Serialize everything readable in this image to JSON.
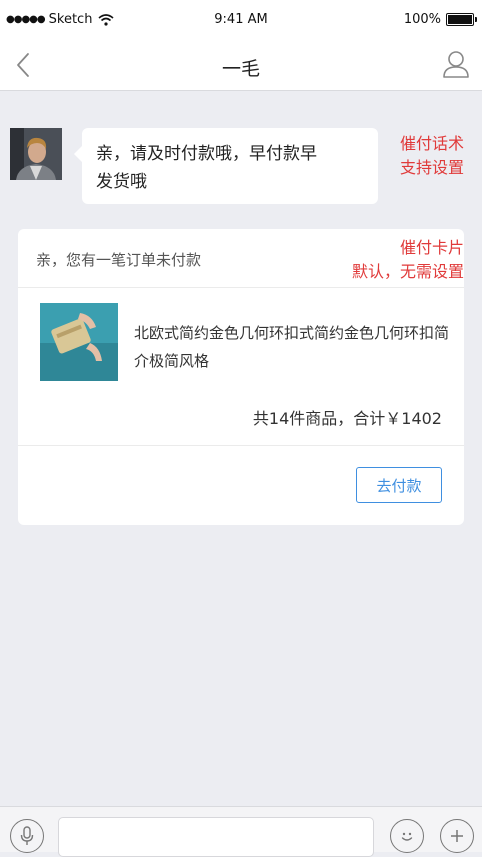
{
  "status_bar": {
    "signal": "●●●●●",
    "carrier": "Sketch",
    "time": "9:41 AM",
    "battery": "100%"
  },
  "nav": {
    "title": "一毛"
  },
  "message": {
    "text_line1": "亲，请及时付款哦，早付款早",
    "text_line2": "发货哦"
  },
  "annotations": {
    "reminder_line1": "催付话术",
    "reminder_line2": "支持设置",
    "card_line1": "催付卡片",
    "card_line2": "默认，无需设置"
  },
  "order_card": {
    "header": "亲，您有一笔订单未付款",
    "product_title": "北欧式简约金色几何环扣式简约金色几何环扣简介极简风格",
    "summary": "共14件商品，合计￥1402",
    "pay_button": "去付款"
  },
  "colors": {
    "background": "#ecedf2",
    "annotation": "#e03a3a",
    "accent": "#3f8fe0"
  },
  "icons": [
    "back-icon",
    "profile-icon",
    "wifi-icon",
    "battery-icon",
    "microphone-icon",
    "emoji-icon",
    "plus-icon"
  ]
}
